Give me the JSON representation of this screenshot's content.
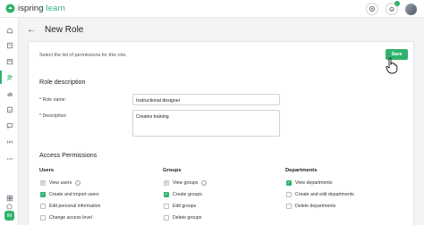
{
  "app": {
    "logo_text_1": "ispring",
    "logo_text_2": " learn"
  },
  "header": {
    "title": "New Role"
  },
  "toolbar": {
    "save_label": "Save"
  },
  "instructions": "Select the list of permissions for this role.",
  "role_description": {
    "title": "Role description",
    "name_label": "* Role name:",
    "name_value": "Instructional designer",
    "desc_label": "* Description:",
    "desc_value": "Creates training"
  },
  "access": {
    "title": "Access Permissions",
    "users": {
      "title": "Users",
      "items": [
        {
          "label": "View users",
          "state": "locked"
        },
        {
          "label": "Create and import users",
          "state": "checked"
        },
        {
          "label": "Edit personal information",
          "state": "unchecked"
        },
        {
          "label": "Change access level",
          "state": "unchecked"
        }
      ]
    },
    "groups": {
      "title": "Groups",
      "items": [
        {
          "label": "View groups",
          "state": "locked"
        },
        {
          "label": "Create groups",
          "state": "checked"
        },
        {
          "label": "Edit groups",
          "state": "unchecked"
        },
        {
          "label": "Delete groups",
          "state": "unchecked"
        }
      ]
    },
    "departments": {
      "title": "Departments",
      "items": [
        {
          "label": "View departments",
          "state": "checked"
        },
        {
          "label": "Create and edit departments",
          "state": "unchecked"
        },
        {
          "label": "Delete departments",
          "state": "unchecked"
        }
      ]
    }
  },
  "sidebar": {
    "user_initials": "IM",
    "icons": [
      "home-icon",
      "book-icon",
      "calendar-icon",
      "users-icon",
      "chart-icon",
      "report-icon",
      "chat-icon",
      "broadcast-icon",
      "more-icon",
      "apps-icon",
      "help-icon"
    ]
  },
  "colors": {
    "accent": "#2fb36b",
    "background": "#f2f3f5"
  }
}
